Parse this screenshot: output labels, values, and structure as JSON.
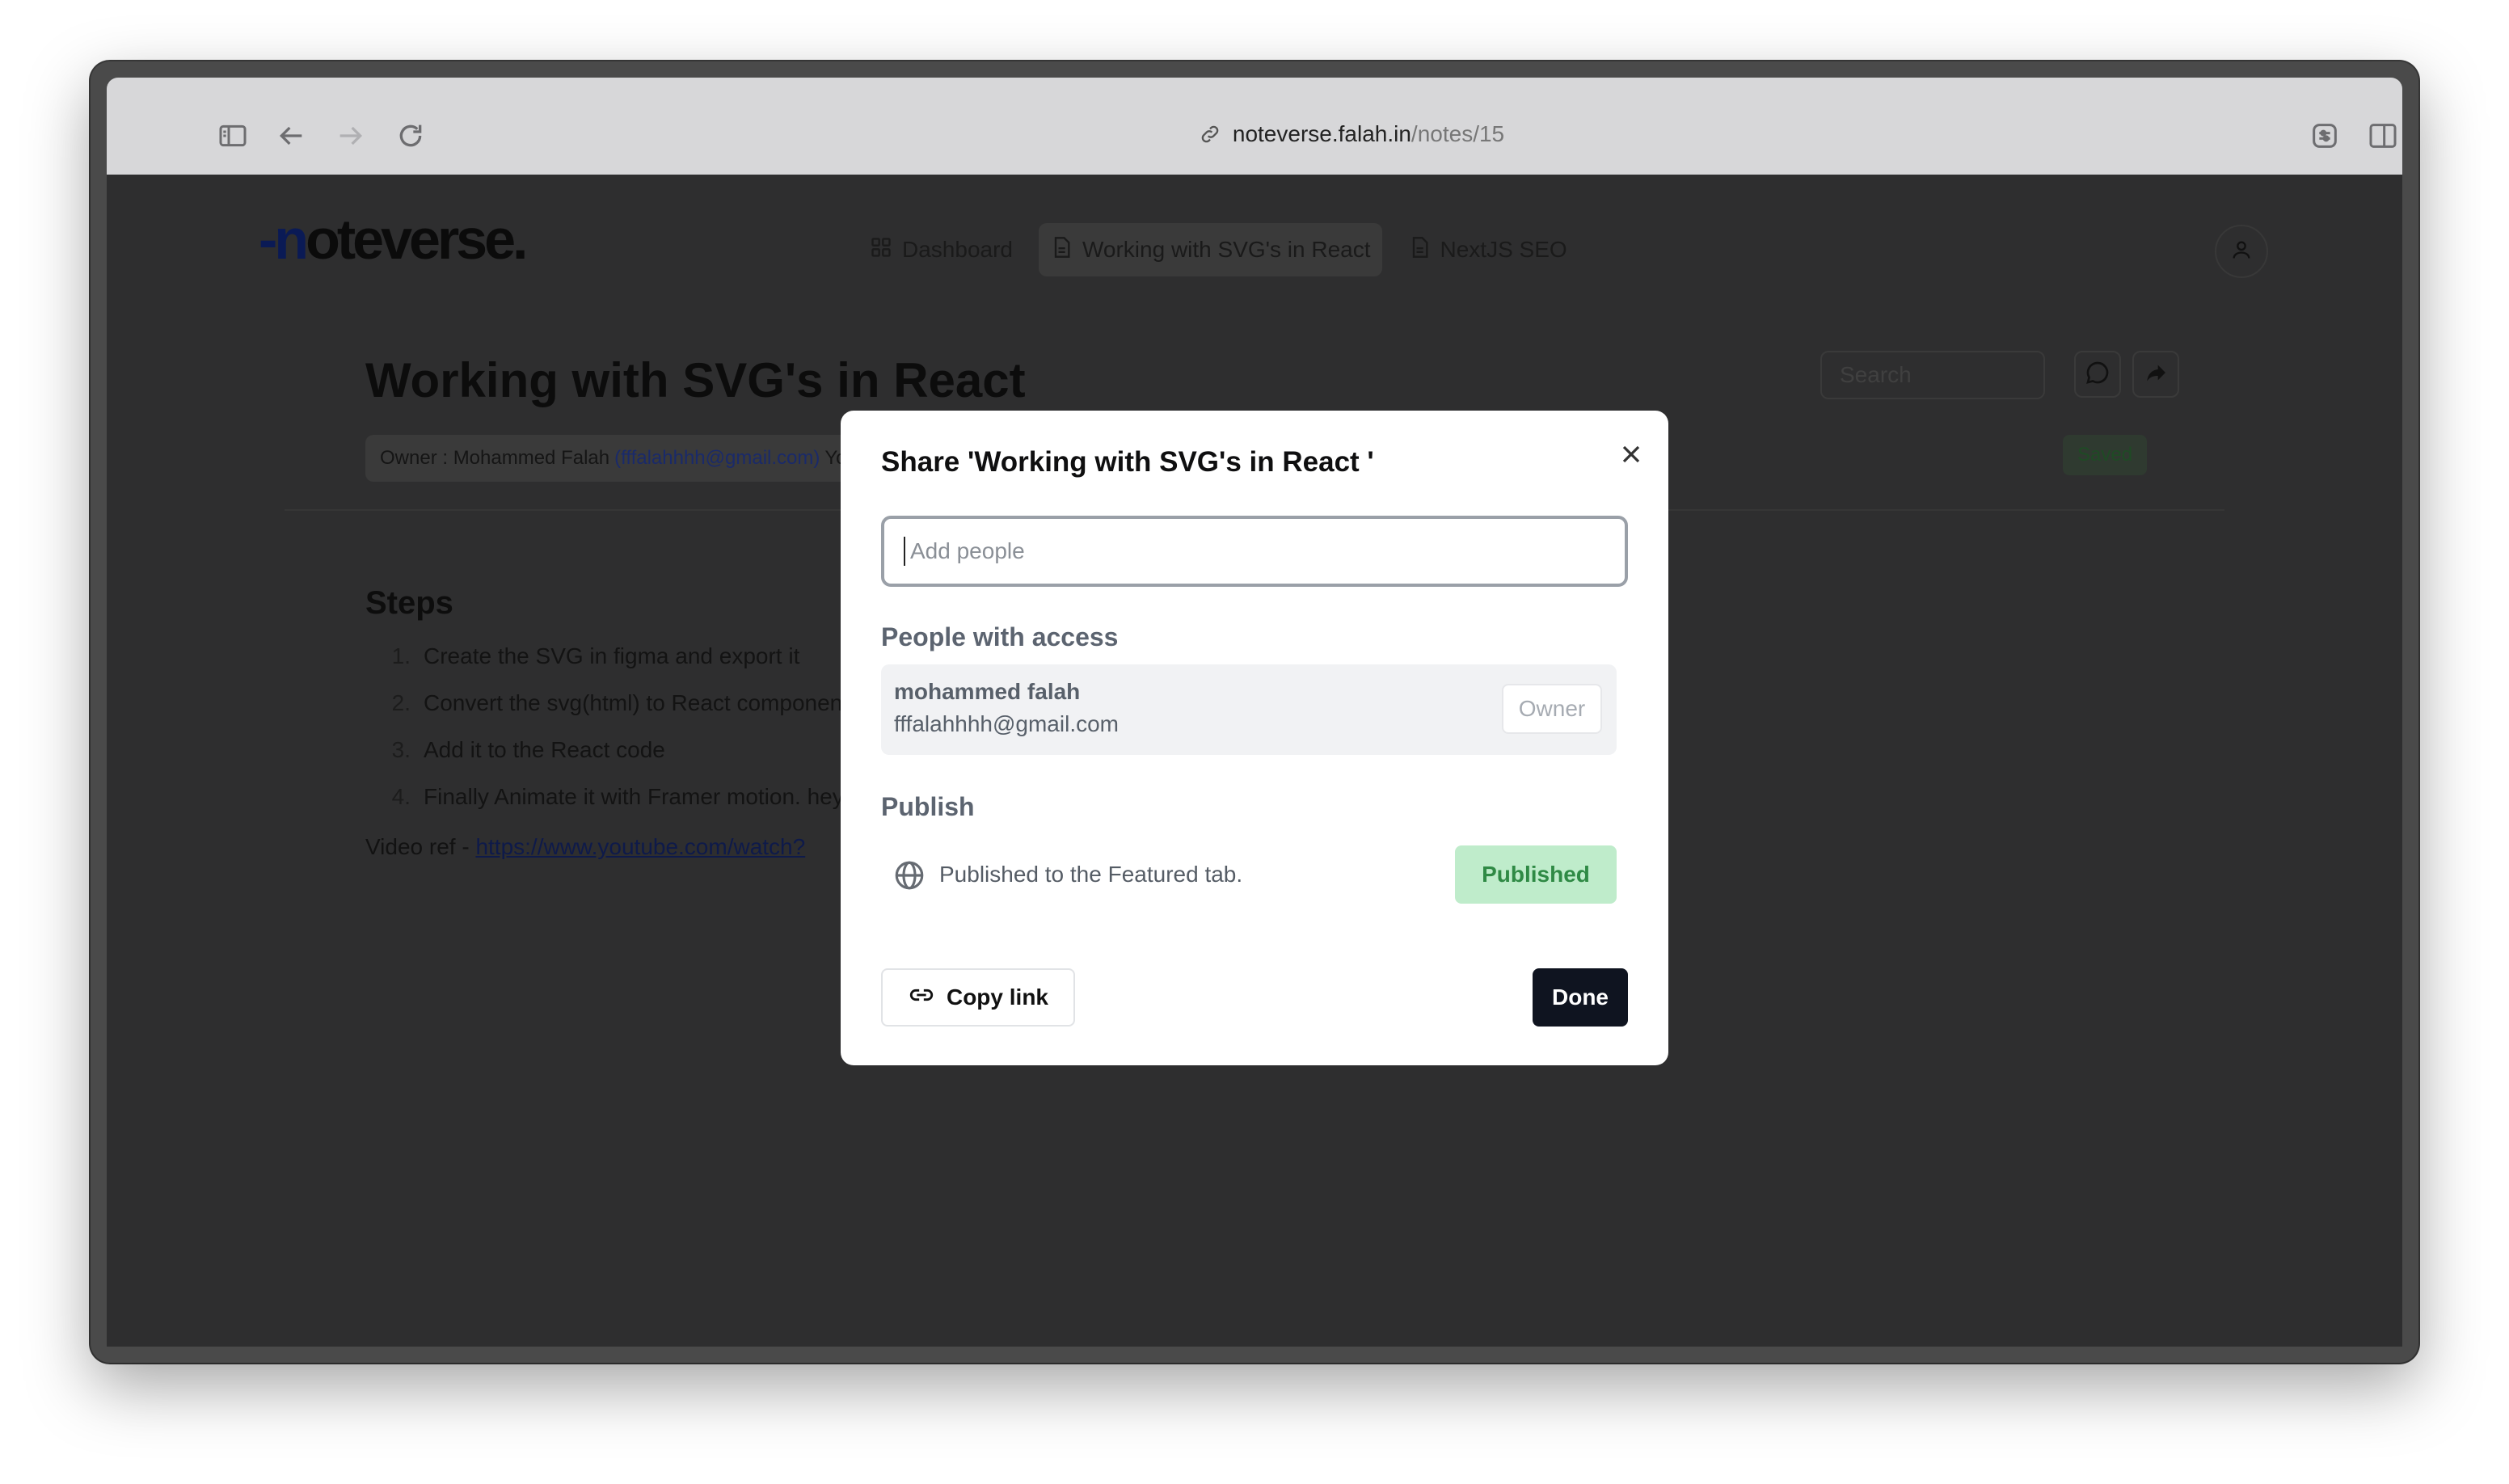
{
  "browser": {
    "url_host": "noteverse.falah.in",
    "url_path": "/notes/15"
  },
  "header": {
    "logo": "noteverse",
    "nav": [
      {
        "label": "Dashboard",
        "icon": "grid-icon"
      },
      {
        "label": "Working with SVG's in React",
        "icon": "document-icon",
        "active": true
      },
      {
        "label": "NextJS SEO",
        "icon": "document-icon"
      }
    ]
  },
  "note": {
    "title": "Working with SVG's in React",
    "owner_prefix": "Owner : Mohammed Falah",
    "owner_email": "(fffalahhhh@gmail.com)",
    "owner_suffix": "You",
    "search_placeholder": "Search",
    "status": "Saved",
    "steps_heading": "Steps",
    "steps": [
      "Create the SVG in figma and export it",
      "Convert the svg(html) to React component",
      "Add it to the React code",
      "Finally Animate it with Framer motion. hey"
    ],
    "video_ref_label": "Video ref - ",
    "video_ref_link": "https://www.youtube.com/watch?"
  },
  "modal": {
    "title": "Share 'Working with SVG's in React '",
    "add_people_placeholder": "Add people",
    "access_heading": "People with access",
    "people": [
      {
        "name": "mohammed falah",
        "email": "fffalahhhh@gmail.com",
        "role": "Owner"
      }
    ],
    "publish_heading": "Publish",
    "publish_text": "Published to the Featured tab.",
    "publish_button": "Published",
    "copy_link": "Copy link",
    "done": "Done"
  },
  "colors": {
    "published_bg": "#bfeccb",
    "published_text": "#2f8a45",
    "done_bg": "#0f1420"
  }
}
